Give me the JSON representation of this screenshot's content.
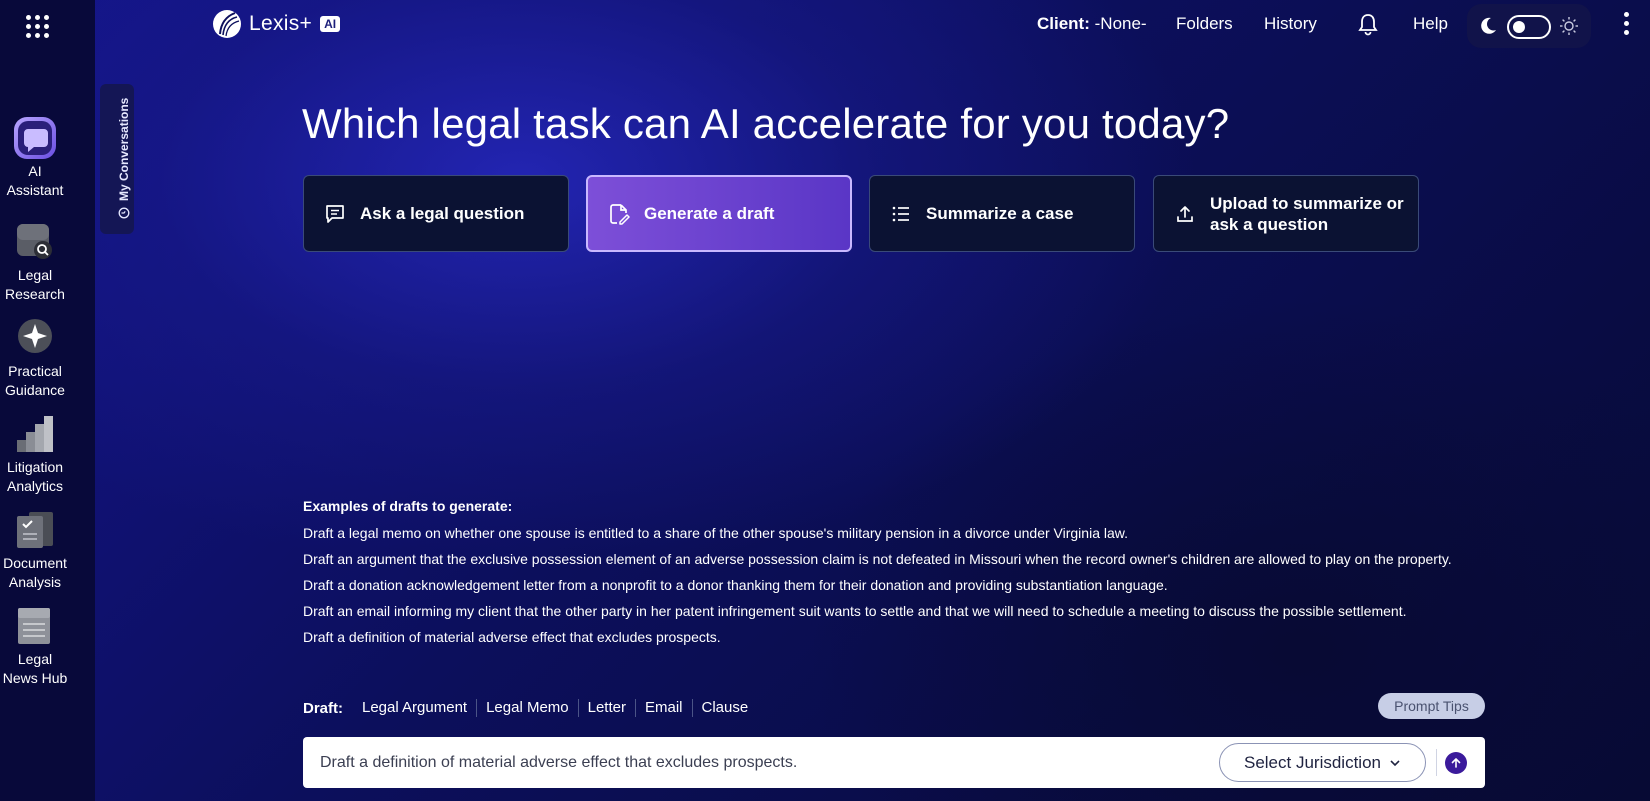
{
  "colors": {
    "sidebar_bg": "#08093a",
    "accent_purple": "#6b43d0",
    "card_bg": "#0b1233"
  },
  "sidebar": {
    "menu_icon": "grid-icon",
    "items": [
      {
        "line1": "AI",
        "line2": "Assistant",
        "icon": "ai-assistant-icon"
      },
      {
        "line1": "Legal",
        "line2": "Research",
        "icon": "legal-research-icon"
      },
      {
        "line1": "Practical",
        "line2": "Guidance",
        "icon": "practical-guidance-icon"
      },
      {
        "line1": "Litigation",
        "line2": "Analytics",
        "icon": "litigation-analytics-icon"
      },
      {
        "line1": "Document",
        "line2": "Analysis",
        "icon": "document-analysis-icon"
      },
      {
        "line1": "Legal",
        "line2": "News Hub",
        "icon": "legal-news-hub-icon"
      }
    ],
    "conversations_tab": "My Conversations"
  },
  "header": {
    "logo_text": "Lexis+",
    "logo_badge": "AI",
    "client_label": "Client:",
    "client_value": "-None-",
    "folders": "Folders",
    "history": "History",
    "help": "Help",
    "theme": "dark"
  },
  "main": {
    "headline": "Which legal task can AI accelerate for you today?",
    "tasks": [
      {
        "label": "Ask a legal question",
        "icon": "chat-icon",
        "active": false
      },
      {
        "label": "Generate a draft",
        "icon": "draft-icon",
        "active": true
      },
      {
        "label": "Summarize a case",
        "icon": "list-icon",
        "active": false
      },
      {
        "label": "Upload to summarize or ask a question",
        "icon": "upload-icon",
        "active": false
      }
    ],
    "examples_title": "Examples of drafts to generate:",
    "examples": [
      "Draft a legal memo on whether one spouse is entitled to a share of the other spouse's military pension in a divorce under Virginia law.",
      "Draft an argument that the exclusive possession element of an adverse possession claim is not defeated in Missouri when the record owner's children are allowed to play on the property.",
      "Draft a donation acknowledgement letter from a nonprofit to a donor thanking them for their donation and providing substantiation language.",
      "Draft an email informing my client that the other party in her patent infringement suit wants to settle and that we will need to schedule a meeting to discuss the possible settlement.",
      "Draft a definition of material adverse effect that excludes prospects."
    ],
    "draft_label": "Draft:",
    "draft_types": [
      "Legal Argument",
      "Legal Memo",
      "Letter",
      "Email",
      "Clause"
    ],
    "prompt_tips": "Prompt Tips",
    "prompt_value": "Draft a definition of material adverse effect that excludes prospects.",
    "jurisdiction": "Select Jurisdiction"
  }
}
